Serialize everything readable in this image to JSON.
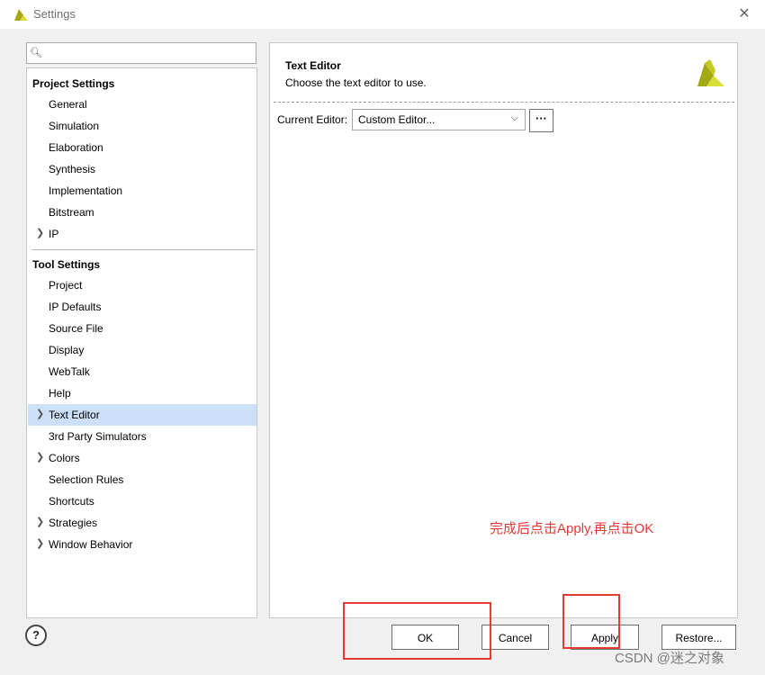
{
  "window": {
    "title": "Settings",
    "close_glyph": "✕"
  },
  "search": {
    "placeholder": "",
    "value": ""
  },
  "sidebar": {
    "project_settings": {
      "header": "Project Settings",
      "items": [
        {
          "label": "General"
        },
        {
          "label": "Simulation"
        },
        {
          "label": "Elaboration"
        },
        {
          "label": "Synthesis"
        },
        {
          "label": "Implementation"
        },
        {
          "label": "Bitstream"
        },
        {
          "label": "IP",
          "expandable": true
        }
      ]
    },
    "tool_settings": {
      "header": "Tool Settings",
      "items": [
        {
          "label": "Project"
        },
        {
          "label": "IP Defaults"
        },
        {
          "label": "Source File"
        },
        {
          "label": "Display"
        },
        {
          "label": "WebTalk"
        },
        {
          "label": "Help"
        },
        {
          "label": "Text Editor",
          "expandable": true,
          "selected": true
        },
        {
          "label": "3rd Party Simulators"
        },
        {
          "label": "Colors",
          "expandable": true
        },
        {
          "label": "Selection Rules"
        },
        {
          "label": "Shortcuts"
        },
        {
          "label": "Strategies",
          "expandable": true
        },
        {
          "label": "Window Behavior",
          "expandable": true
        }
      ]
    }
  },
  "content": {
    "title": "Text Editor",
    "description": "Choose the text editor to use.",
    "current_editor_label": "Current Editor:",
    "current_editor_value": "Custom Editor...",
    "browse_label": "···"
  },
  "annotation": {
    "text": "完成后点击Apply,再点击OK",
    "color": "#e53935"
  },
  "footer": {
    "help_label": "?",
    "ok_label": "OK",
    "cancel_label": "Cancel",
    "apply_label": "Apply",
    "restore_label": "Restore..."
  },
  "watermark": "CSDN @迷之对象",
  "colors": {
    "selection": "#cce0f9",
    "logo_dark": "#a3a814",
    "logo_light": "#d9de3a",
    "highlight_box": "#e53935"
  }
}
